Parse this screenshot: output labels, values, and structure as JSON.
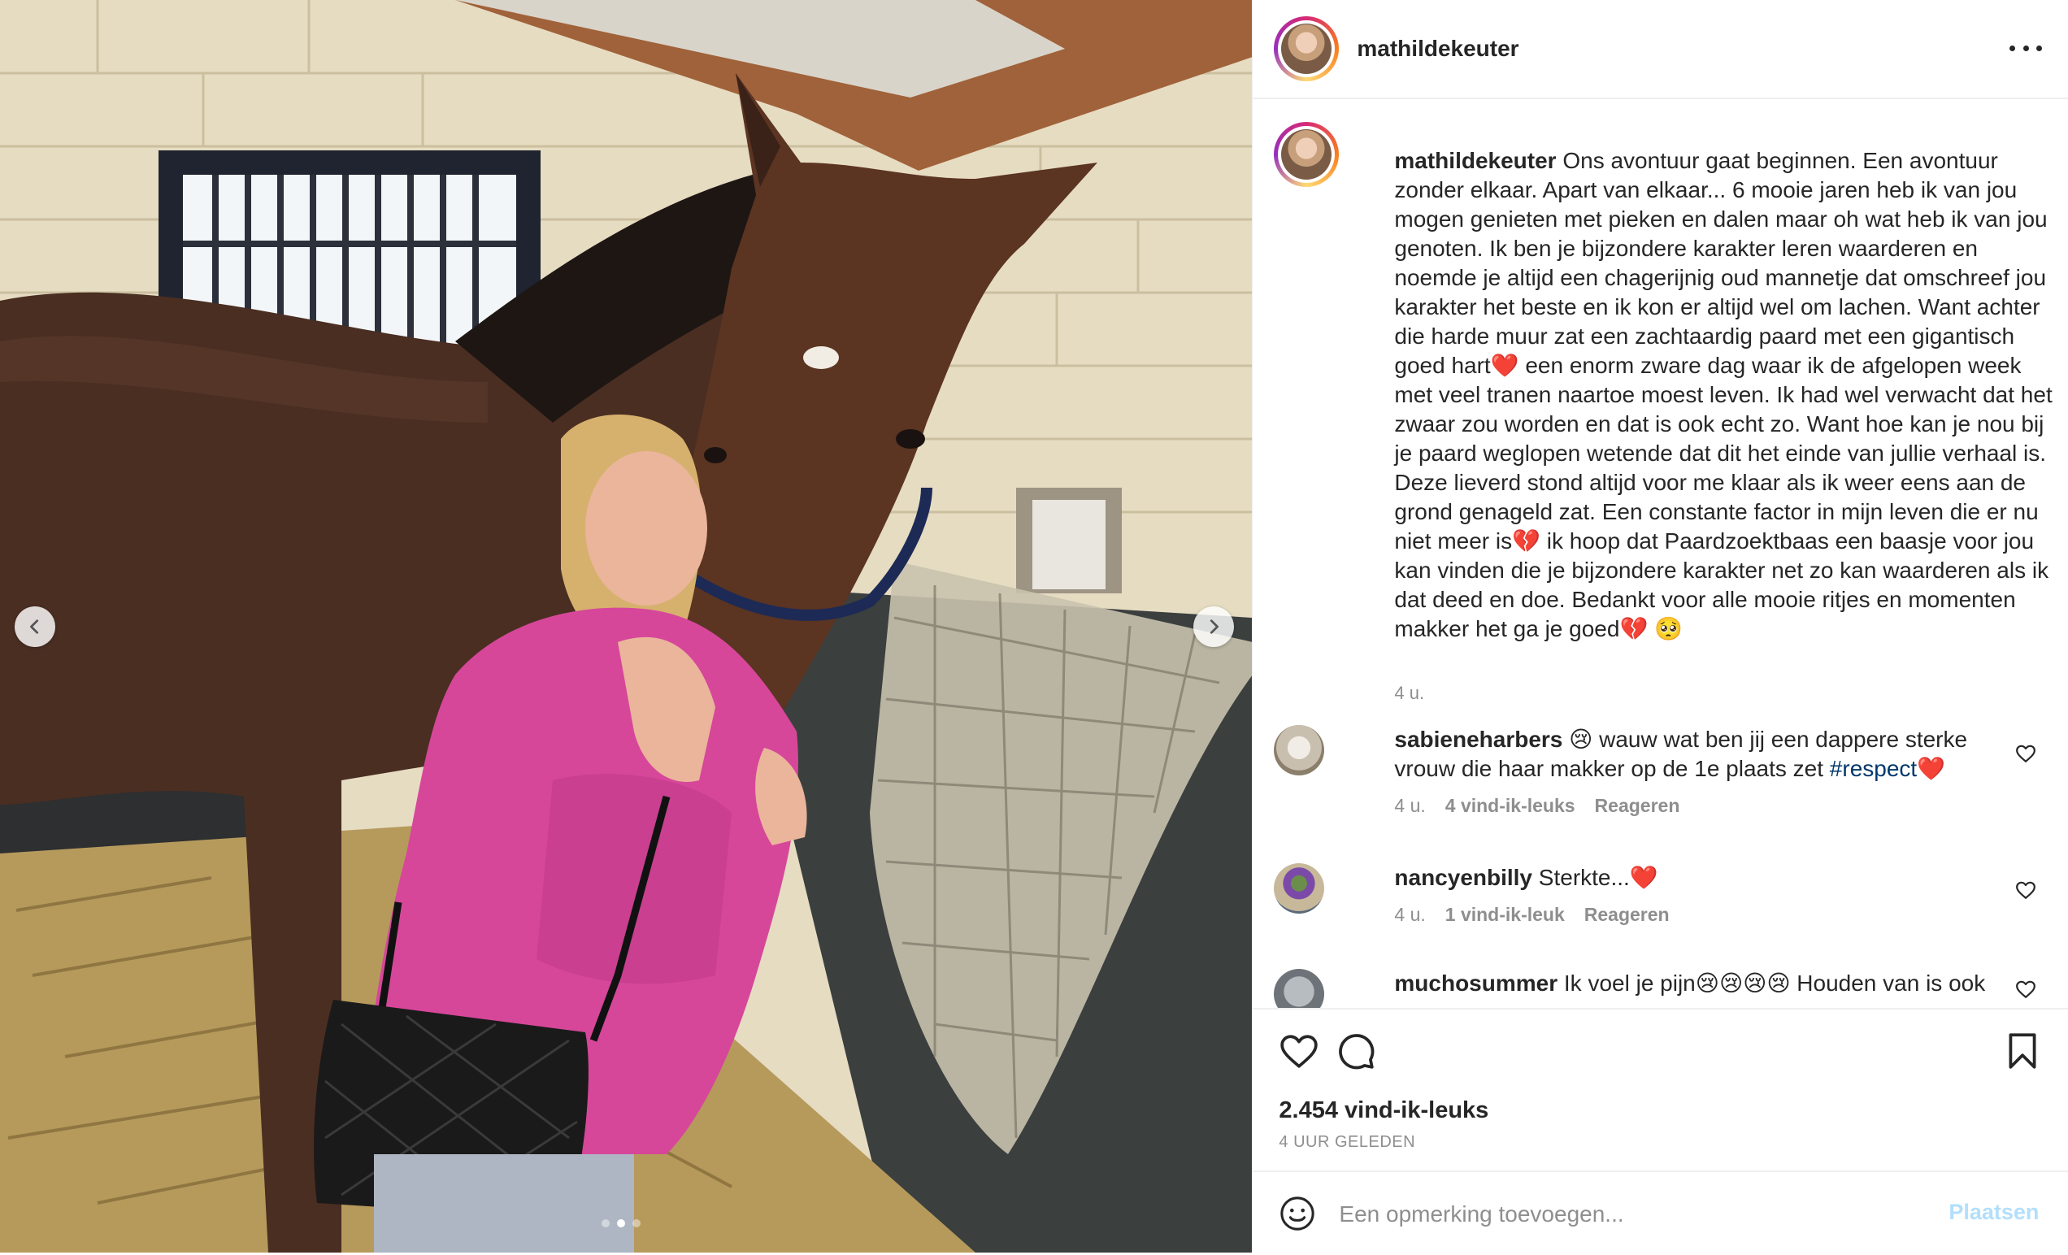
{
  "post": {
    "username": "mathildekeuter",
    "caption_username": "mathildekeuter",
    "caption": "Ons avontuur gaat beginnen. Een avontuur zonder elkaar. Apart van elkaar... 6 mooie jaren heb ik van jou mogen genieten met pieken en dalen maar oh wat heb ik van jou genoten. Ik ben je bijzondere karakter leren waarderen en noemde je altijd een chagerijnig oud mannetje dat omschreef jou karakter het beste en ik kon er altijd wel om lachen. Want achter die harde muur zat een zachtaardig paard met een gigantisch goed hart❤️ een enorm zware dag waar ik de afgelopen week met veel tranen naartoe moest leven. Ik had wel verwacht dat het zwaar zou worden en dat is ook echt zo. Want hoe kan je nou bij je paard weglopen wetende dat dit het einde van jullie verhaal is. Deze lieverd stond altijd voor me klaar als ik weer eens aan de grond genageld zat. Een constante factor in mijn leven die er nu niet meer is💔 ik hoop dat Paardzoektbaas een baasje voor jou kan vinden die je bijzondere karakter net zo kan waarderen als ik dat deed en doe. Bedankt voor alle mooie ritjes en momenten makker het ga je goed💔 🥺",
    "caption_time": "4 u.",
    "likes": "2.454 vind-ik-leuks",
    "posted": "4 UUR GELEDEN",
    "carousel": {
      "slides": 3,
      "active": 1
    }
  },
  "comments": [
    {
      "username": "sabieneharbers",
      "text": "😢 wauw wat ben jij een dappere sterke vrouw die haar makker op de 1e plaats zet ",
      "hashtag": "#respect",
      "suffix": "❤️",
      "time": "4 u.",
      "likes": "4 vind-ik-leuks",
      "reply": "Reageren"
    },
    {
      "username": "nancyenbilly",
      "text": "Sterkte...❤️",
      "time": "4 u.",
      "likes": "1 vind-ik-leuk",
      "reply": "Reageren"
    },
    {
      "username": "muchosummer",
      "text": "Ik voel je pijn😢😢😢😢 Houden van is ook"
    }
  ],
  "add_comment": {
    "placeholder": "Een opmerking toevoegen...",
    "post_label": "Plaatsen"
  },
  "icons": {
    "more": "more-options-icon",
    "like": "heart-icon",
    "comment": "comment-icon",
    "save": "bookmark-icon",
    "emoji": "emoji-icon",
    "prev": "chevron-left-icon",
    "next": "chevron-right-icon"
  },
  "colors": {
    "link": "#00376b",
    "muted": "#8e8e8e",
    "post_disabled": "#b2dffc",
    "heart": "#e0245e"
  }
}
